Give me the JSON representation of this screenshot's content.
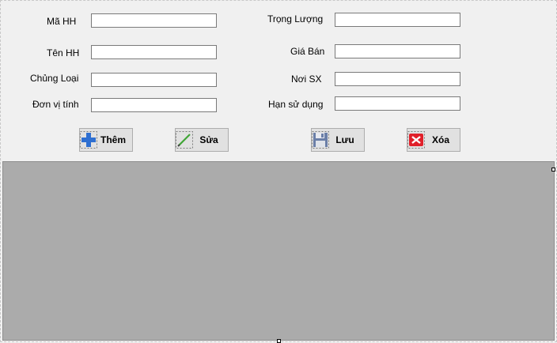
{
  "form": {
    "labels": {
      "ma_hh": "Mã HH",
      "ten_hh": "Tên HH",
      "chung_loai": "Chủng Loại",
      "don_vi_tinh": "Đơn vị tính",
      "trong_luong": "Trọng Lượng",
      "gia_ban": "Giá Bán",
      "noi_sx": "Nơi SX",
      "han_su_dung": "Hạn sử dụng"
    },
    "values": {
      "ma_hh": "",
      "ten_hh": "",
      "chung_loai": "",
      "don_vi_tinh": "",
      "trong_luong": "",
      "gia_ban": "",
      "noi_sx": "",
      "han_su_dung": ""
    }
  },
  "toolbar": {
    "add_label": "Thêm",
    "edit_label": "Sửa",
    "save_label": "Lưu",
    "delete_label": "Xóa",
    "icons": {
      "add": "plus-icon",
      "edit": "pencil-icon",
      "save": "floppy-disk-icon",
      "delete": "close-icon"
    }
  },
  "colors": {
    "grid_background": "#ababab",
    "form_background": "#f0f0f0",
    "add_icon": "#2e6fd1",
    "delete_icon": "#e0202a",
    "edit_icon": "#3fa535"
  }
}
